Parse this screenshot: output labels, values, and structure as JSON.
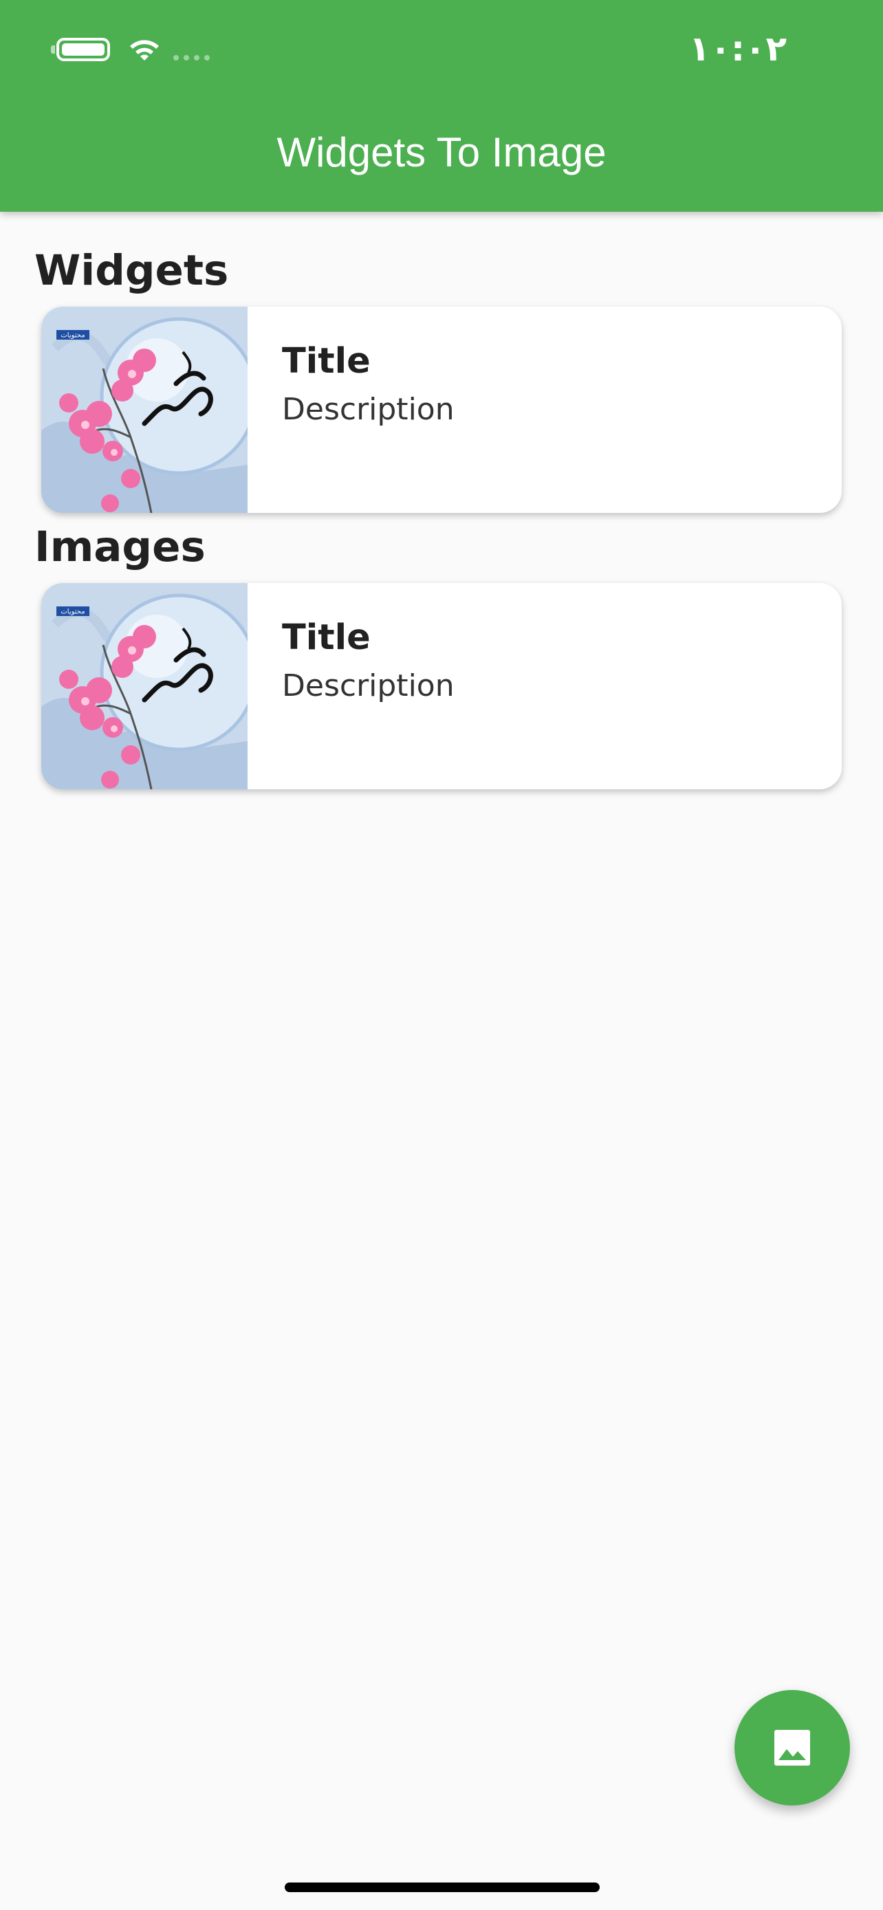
{
  "status_bar": {
    "time": "١٠:٠٢",
    "battery_icon": "battery-icon",
    "wifi_icon": "wifi-icon",
    "signal_icon": "signal-icon"
  },
  "app_bar": {
    "title": "Widgets To Image",
    "color": "#4caf50"
  },
  "sections": [
    {
      "heading": "Widgets",
      "card": {
        "thumbnail_badge": "محتويات",
        "title": "Title",
        "description": "Description"
      }
    },
    {
      "heading": "Images",
      "card": {
        "thumbnail_badge": "محتويات",
        "title": "Title",
        "description": "Description"
      }
    }
  ],
  "fab": {
    "icon": "image-icon",
    "color": "#4caf50"
  }
}
